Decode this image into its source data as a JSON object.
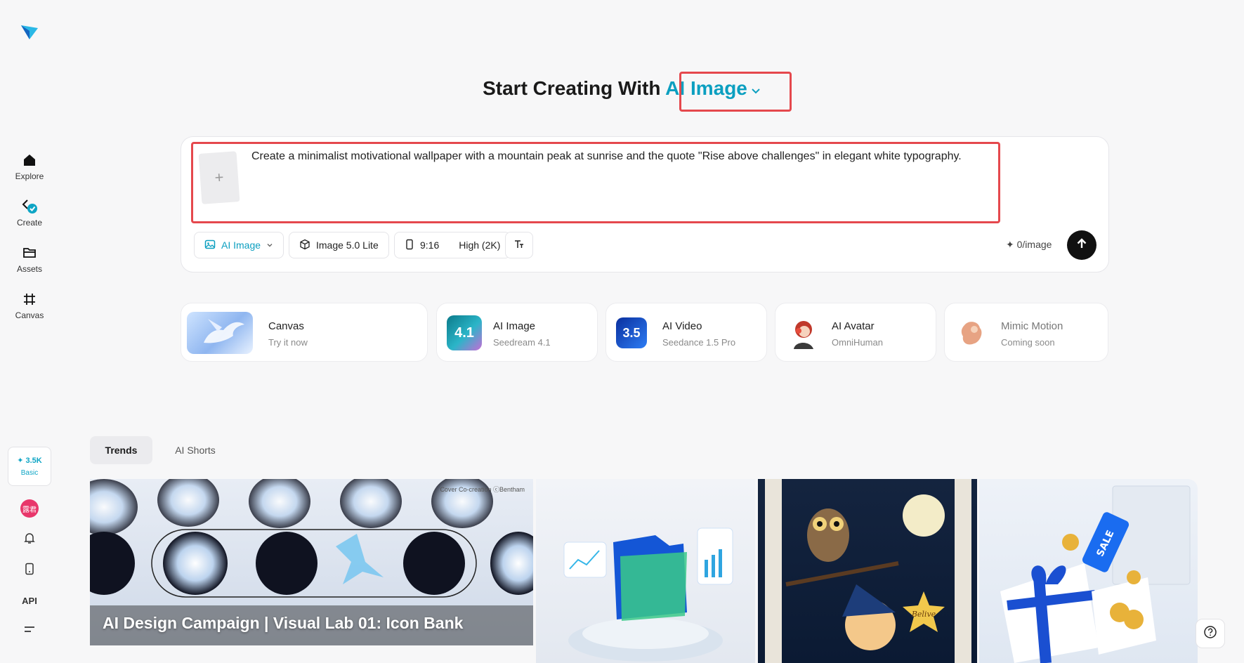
{
  "sidebar": {
    "items": [
      {
        "label": "Explore",
        "icon": "home-icon"
      },
      {
        "label": "Create",
        "icon": "create-icon"
      },
      {
        "label": "Assets",
        "icon": "folder-icon"
      },
      {
        "label": "Canvas",
        "icon": "canvas-icon"
      }
    ],
    "credits": {
      "value": "✦ 3.5K",
      "plan": "Basic"
    },
    "avatar_text": "露君",
    "api_label": "API"
  },
  "heading": {
    "prefix": "Start Creating With",
    "mode": "AI Image"
  },
  "prompt": {
    "text": "Create a minimalist motivational wallpaper with a mountain peak at sunrise and the quote \"Rise above challenges\" in elegant white typography.",
    "upload_symbol": "+"
  },
  "toolbar": {
    "mode_label": "AI Image",
    "model_label": "Image 5.0 Lite",
    "ratio_label": "9:16",
    "quality_label": "High (2K)",
    "credit_rate": "✦ 0/image"
  },
  "features": [
    {
      "title": "Canvas",
      "subtitle": "Try it now"
    },
    {
      "title": "AI Image",
      "subtitle": "Seedream 4.1",
      "badge": "4.1"
    },
    {
      "title": "AI Video",
      "subtitle": "Seedance 1.5 Pro",
      "badge": "3.5"
    },
    {
      "title": "AI Avatar",
      "subtitle": "OmniHuman"
    },
    {
      "title": "Mimic Motion",
      "subtitle": "Coming soon"
    }
  ],
  "tabs": [
    "Trends",
    "AI Shorts"
  ],
  "gallery": {
    "caption": "AI Design Campaign | Visual Lab 01: Icon Bank",
    "credit": "Cover Co-creation ⓒBentham",
    "star_text": "Belive",
    "sale_text": "SALE"
  },
  "colors": {
    "accent": "#0b9fc0",
    "highlight": "#e5484d",
    "background": "#f7f7f8"
  }
}
